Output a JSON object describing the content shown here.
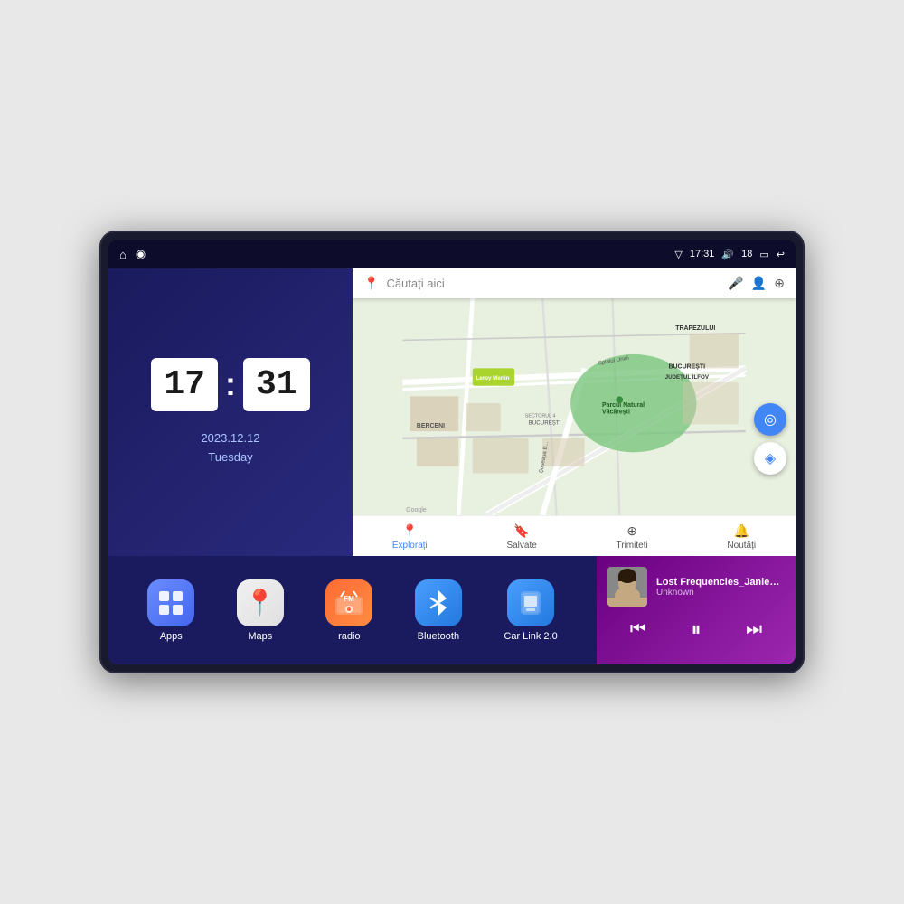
{
  "device": {
    "screen_bg": "#1a1a6e"
  },
  "status_bar": {
    "signal_icon": "▽",
    "time": "17:31",
    "volume_icon": "🔊",
    "battery_level": "18",
    "battery_icon": "▭",
    "back_icon": "↩"
  },
  "clock": {
    "hour": "17",
    "minute": "31",
    "date": "2023.12.12",
    "day": "Tuesday"
  },
  "map": {
    "search_placeholder": "Căutați aici",
    "nav_items": [
      {
        "label": "Explorați",
        "icon": "📍",
        "active": true
      },
      {
        "label": "Salvate",
        "icon": "🔖",
        "active": false
      },
      {
        "label": "Trimiteți",
        "icon": "⊕",
        "active": false
      },
      {
        "label": "Noutăți",
        "icon": "🔔",
        "active": false
      }
    ],
    "location_labels": [
      "TRAPEZULUI",
      "BUCUREȘTI",
      "JUDEȚUL ILFOV",
      "BERCENI"
    ],
    "places": [
      "Leroy Merlin",
      "Parcul Natural Văcărești",
      "BUCUREȘTI SECTORUL 4"
    ]
  },
  "apps": [
    {
      "label": "Apps",
      "icon": "⊞",
      "class": "icon-apps"
    },
    {
      "label": "Maps",
      "icon": "📍",
      "class": "icon-maps"
    },
    {
      "label": "radio",
      "icon": "📻",
      "class": "icon-radio"
    },
    {
      "label": "Bluetooth",
      "icon": "🔷",
      "class": "icon-bt"
    },
    {
      "label": "Car Link 2.0",
      "icon": "📱",
      "class": "icon-carlink"
    }
  ],
  "music": {
    "title": "Lost Frequencies_Janieck Devy-...",
    "artist": "Unknown",
    "prev_icon": "⏮",
    "play_icon": "⏸",
    "next_icon": "⏭"
  },
  "home_icon": "⌂",
  "nav_icon": "◉"
}
